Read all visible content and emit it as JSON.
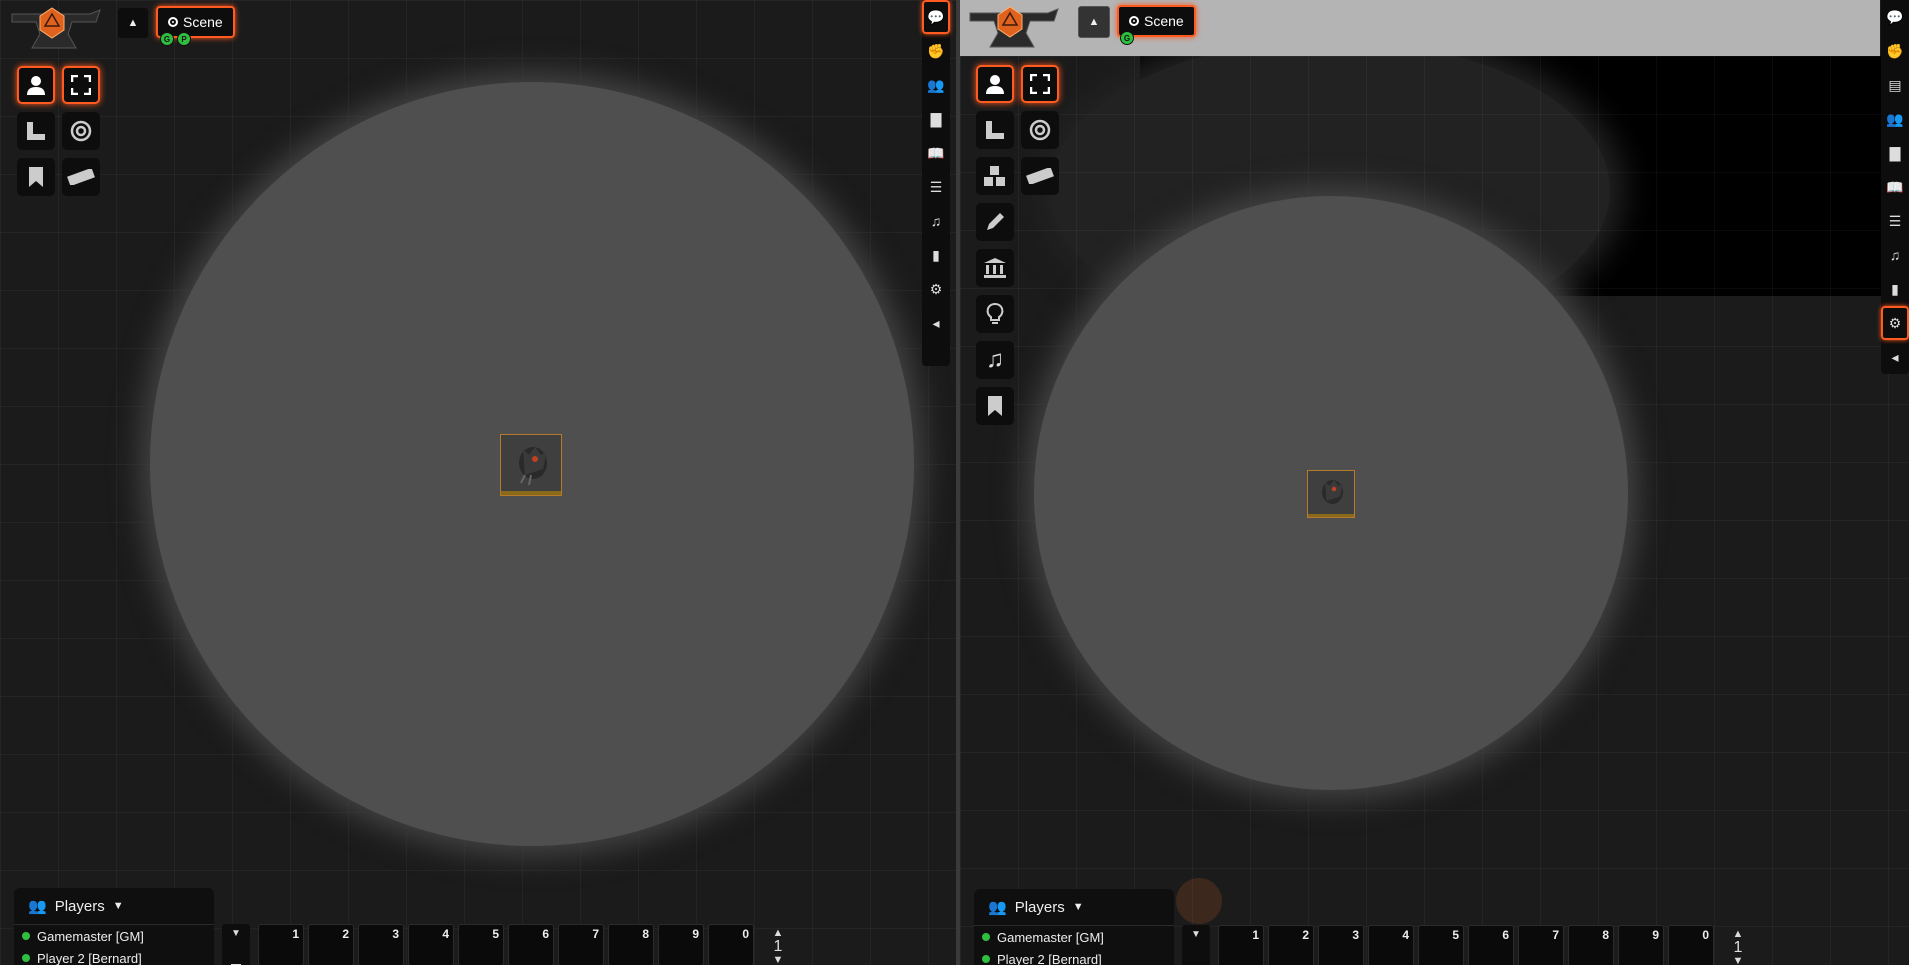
{
  "left": {
    "scene_label": "Scene",
    "scene_badges": [
      "G",
      "P"
    ],
    "players_label": "Players",
    "players": [
      "Gamemaster [GM]",
      "Player 2 [Bernard]"
    ],
    "hotbar_slots": [
      "1",
      "2",
      "3",
      "4",
      "5",
      "6",
      "7",
      "8",
      "9",
      "0"
    ],
    "hotbar_page": "1"
  },
  "right": {
    "scene_label": "Scene",
    "scene_badges": [
      "G"
    ],
    "players_label": "Players",
    "players": [
      "Gamemaster [GM]",
      "Player 2 [Bernard]"
    ],
    "hotbar_slots": [
      "1",
      "2",
      "3",
      "4",
      "5",
      "6",
      "7",
      "8",
      "9",
      "0"
    ],
    "hotbar_page": "1"
  },
  "colors": {
    "accent": "#ff5a1f",
    "online": "#2fbf3f",
    "light": "#4f4f4f"
  },
  "icons": {
    "left_controls": [
      "token-controls-icon",
      "fullscreen-icon",
      "measure-icon",
      "target-icon",
      "notes-icon",
      "ruler-icon"
    ],
    "right_controls": [
      "token-controls-icon",
      "fullscreen-icon",
      "measure-icon",
      "target-icon",
      "tiles-icon",
      "ruler-icon",
      "drawing-icon",
      "walls-icon",
      "lighting-icon",
      "sounds-icon",
      "notes-icon"
    ],
    "sidebar": [
      "chat-icon",
      "combat-icon",
      "map-icon",
      "actors-icon",
      "items-icon",
      "journal-icon",
      "tables-icon",
      "playlists-icon",
      "compendium-icon",
      "settings-icon",
      "collapse-icon"
    ]
  }
}
